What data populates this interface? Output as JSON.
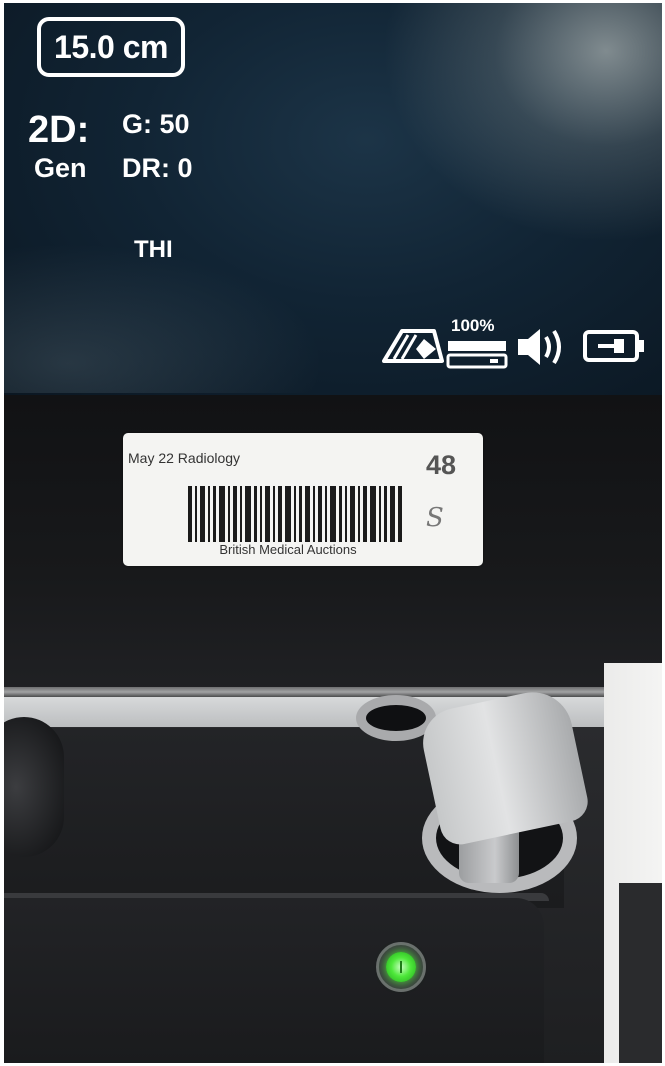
{
  "screen": {
    "depth": "15.0 cm",
    "mode": "2D:",
    "preset": "Gen",
    "gain": "G: 50",
    "dynamic_range": "DR: 0",
    "harmonic": "THI",
    "status": {
      "storage_percent": "100%",
      "icons": [
        "probe-icon",
        "storage-icon",
        "volume-icon",
        "battery-plug-icon"
      ]
    }
  },
  "label": {
    "title": "May 22 Radiology",
    "lot_number": "48",
    "organization": "British Medical Auctions",
    "handwritten_mark": "S",
    "colors": {
      "paper": "#f4f4f2",
      "ink": "#333333"
    }
  },
  "device": {
    "power_indicator_color": "#4ee83a"
  }
}
